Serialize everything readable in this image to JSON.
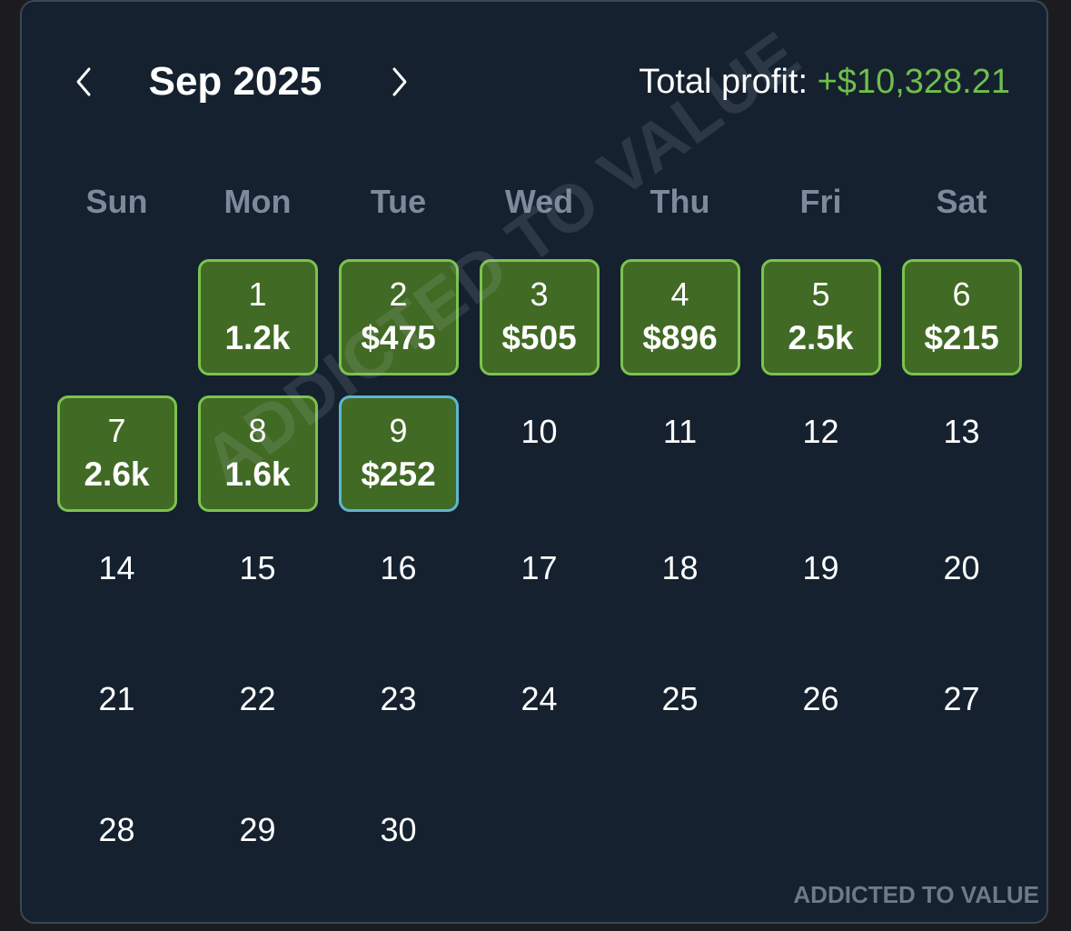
{
  "header": {
    "month_title": "Sep 2025",
    "total_label": "Total profit: ",
    "total_value": "+$10,328.21",
    "prev_icon": "chevron-left-icon",
    "next_icon": "chevron-right-icon"
  },
  "weekdays": [
    "Sun",
    "Mon",
    "Tue",
    "Wed",
    "Thu",
    "Fri",
    "Sat"
  ],
  "days": [
    {
      "day": "1",
      "profit": "1.2k"
    },
    {
      "day": "2",
      "profit": "$475"
    },
    {
      "day": "3",
      "profit": "$505"
    },
    {
      "day": "4",
      "profit": "$896"
    },
    {
      "day": "5",
      "profit": "2.5k"
    },
    {
      "day": "6",
      "profit": "$215"
    },
    {
      "day": "7",
      "profit": "2.6k"
    },
    {
      "day": "8",
      "profit": "1.6k"
    },
    {
      "day": "9",
      "profit": "$252",
      "today": true
    },
    {
      "day": "10"
    },
    {
      "day": "11"
    },
    {
      "day": "12"
    },
    {
      "day": "13"
    },
    {
      "day": "14"
    },
    {
      "day": "15"
    },
    {
      "day": "16"
    },
    {
      "day": "17"
    },
    {
      "day": "18"
    },
    {
      "day": "19"
    },
    {
      "day": "20"
    },
    {
      "day": "21"
    },
    {
      "day": "22"
    },
    {
      "day": "23"
    },
    {
      "day": "24"
    },
    {
      "day": "25"
    },
    {
      "day": "26"
    },
    {
      "day": "27"
    },
    {
      "day": "28"
    },
    {
      "day": "29"
    },
    {
      "day": "30"
    }
  ],
  "first_weekday_index": 1,
  "colors": {
    "background": "#15212f",
    "profit_tile": "#416a24",
    "profit_border": "#7cc24f",
    "today_border": "#5fb6d0",
    "profit_text": "#6fbf4a",
    "weekday_text": "#7c8a9b"
  },
  "watermark": {
    "diagonal": "ADDICTED TO VALUE",
    "footer": "ADDICTED TO VALUE"
  }
}
